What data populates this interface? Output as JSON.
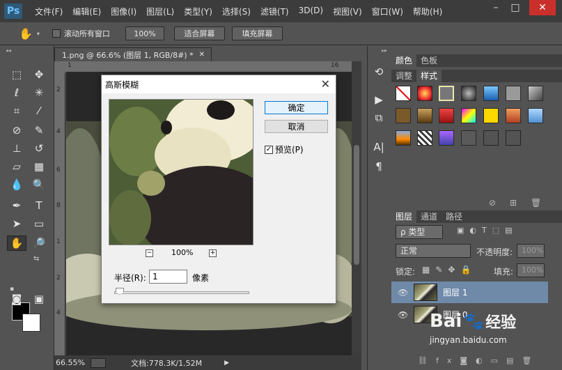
{
  "app": {
    "logo": "Ps",
    "menu": [
      "文件(F)",
      "编辑(E)",
      "图像(I)",
      "图层(L)",
      "类型(Y)",
      "选择(S)",
      "滤镜(T)",
      "3D(D)",
      "视图(V)",
      "窗口(W)",
      "帮助(H)"
    ]
  },
  "options_bar": {
    "scroll_all_label": "滚动所有窗口",
    "zoom_100_label": "100%",
    "fit_screen_label": "适合屏幕",
    "fill_screen_label": "填充屏幕"
  },
  "document": {
    "tab_label": "1.png @ 66.6% (图层 1, RGB/8#) *",
    "ruler_h_ticks": [
      "1",
      "6",
      "8",
      "10",
      "12",
      "14",
      "16"
    ],
    "ruler_v_ticks": [
      "2",
      "4",
      "6",
      "8",
      "1",
      "2",
      "4",
      "1",
      "6"
    ],
    "status_zoom": "66.55%",
    "status_doc": "文档:778.3K/1.52M"
  },
  "dialog": {
    "title": "高斯模糊",
    "ok_label": "确定",
    "cancel_label": "取消",
    "preview_label": "预览(P)",
    "preview_checked": true,
    "zoom_level": "100%",
    "zoom_minus": "−",
    "zoom_plus": "+",
    "radius_label": "半径(R):",
    "radius_value": "1",
    "radius_unit": "像素",
    "radius_slider_fraction": 0.02
  },
  "panels": {
    "color_tabs": [
      "颜色",
      "色板"
    ],
    "adjust_tabs": [
      "调整",
      "样式"
    ],
    "layer_tabs": [
      "图层",
      "通道",
      "路径"
    ],
    "filter_kind": "ρ 类型",
    "blend_mode": "正常",
    "opacity_label": "不透明度:",
    "opacity_value": "100%",
    "lock_label": "锁定:",
    "fill_label": "填充:",
    "fill_value": "100%",
    "layers": [
      {
        "name": "图层 1",
        "selected": true
      },
      {
        "name": "图层 0",
        "selected": false
      }
    ]
  },
  "watermark": {
    "brand": "Bai",
    "brand2": "经验",
    "url": "jingyan.baidu.com"
  }
}
